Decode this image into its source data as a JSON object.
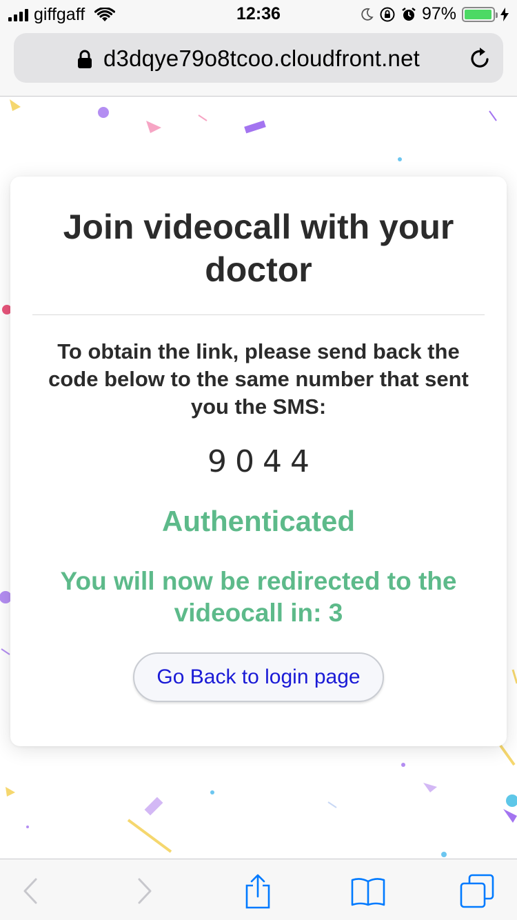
{
  "status_bar": {
    "carrier": "giffgaff",
    "time": "12:36",
    "battery_percent": "97%",
    "battery_level": 0.97
  },
  "browser": {
    "url": "d3dqye79o8tcoo.cloudfront.net"
  },
  "card": {
    "title": "Join videocall with your doctor",
    "instructions": "To obtain the link, please send back the code below to the same number that sent you the SMS:",
    "code": "9044",
    "status": "Authenticated",
    "redirect_message": "You will now be redirected to the videocall in: 3",
    "back_button_label": "Go Back to login page"
  },
  "colors": {
    "success_green": "#5dba8a",
    "link_blue": "#1a1ad6",
    "ios_tint": "#007aff"
  },
  "toolbar": {
    "icons": [
      "back-icon",
      "forward-icon",
      "share-icon",
      "bookmarks-icon",
      "tabs-icon"
    ]
  }
}
